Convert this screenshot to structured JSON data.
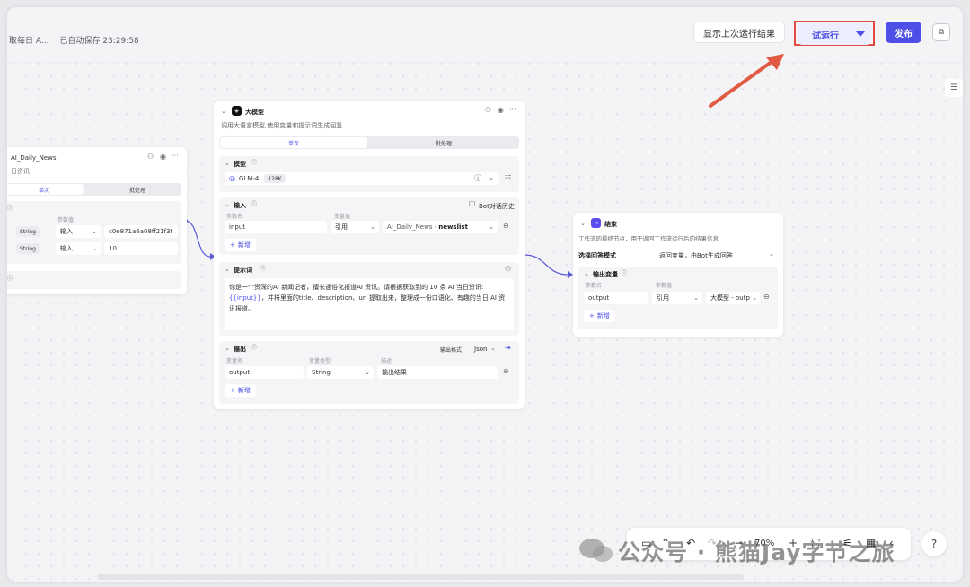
{
  "topbar": {
    "breadcrumb": "取每日 A...",
    "autosave": "已自动保存 23:29:58",
    "show_last_result": "显示上次运行结果",
    "test_run": "试运行",
    "publish": "发布"
  },
  "start_node": {
    "title": "AI_Daily_News",
    "desc": "日资讯",
    "tab_single": "单次",
    "tab_batch": "批处理",
    "param_value_label": "参数值",
    "rows": [
      {
        "type": "String",
        "source": "输入",
        "value": "c0e871a6a08ff21f3t"
      },
      {
        "type": "String",
        "source": "输入",
        "value": "10"
      }
    ]
  },
  "llm_node": {
    "title": "大模型",
    "desc": "调用大语言模型,使用变量和提示词生成回复",
    "tab_single": "单次",
    "tab_batch": "批处理",
    "model_section": "模型",
    "model_name": "GLM-4",
    "model_ctx": "128K",
    "input_section": "输入",
    "bot_history": "Bot对话历史",
    "param_name_label": "参数名",
    "var_value_label": "变量值",
    "input_name": "input",
    "input_ref": "引用",
    "input_src_prefix": "AI_Daily_News - ",
    "input_src_var": "newslist",
    "add": "新增",
    "prompt_section": "提示词",
    "prompt_text_1": "你是一个资深的AI 新闻记者，擅长通俗化报道AI 资讯。请根据获取到的 10 条 AI 当日资讯:",
    "prompt_var": "{{input}}",
    "prompt_text_2": "，并将里面的title、description、url 提取出来，整理成一份口语化、有趣的当日 AI 资讯报道。",
    "output_section": "输出",
    "output_format_label": "输出格式",
    "output_format": "Json",
    "var_name_label": "变量名",
    "var_type_label": "变量类型",
    "desc_label": "描述",
    "output_name": "output",
    "output_type": "String",
    "output_desc": "输出结果"
  },
  "end_node": {
    "title": "结束",
    "desc": "工作流的最终节点，用于返回工作流运行后的结果信息",
    "answer_mode_label": "选择回答模式",
    "answer_mode_value": "返回变量，由Bot生成回答",
    "output_vars": "输出变量",
    "param_name_label": "参数名",
    "param_value_label": "参数值",
    "var_name": "output",
    "var_ref": "引用",
    "var_src": "大模型 - outp",
    "add": "新增"
  },
  "zoombar": {
    "zoom": "70%"
  },
  "watermark": "公众号 · 熊猫Jay字节之旅",
  "colors": {
    "accent": "#4e4fe6",
    "highlight": "#e04b3f",
    "arrow": "#e05a44"
  }
}
